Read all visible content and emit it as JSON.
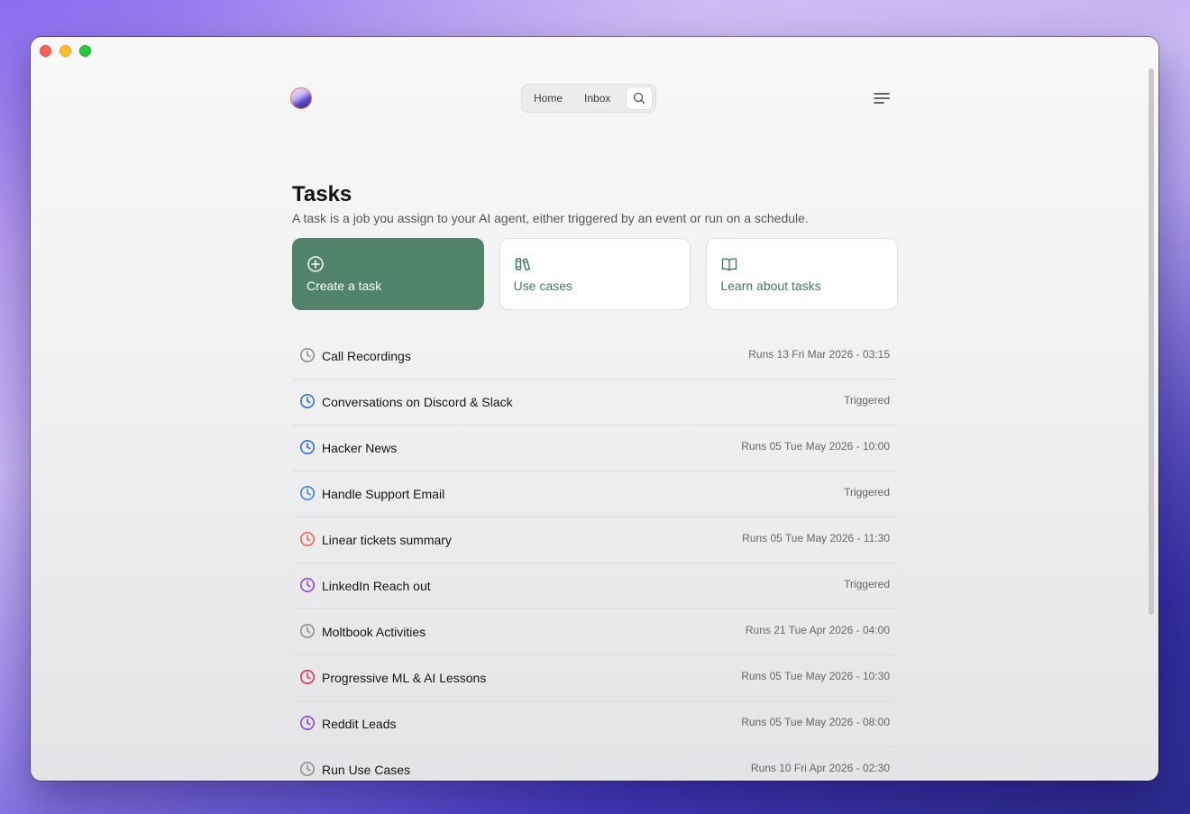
{
  "window": {
    "controls": [
      "close",
      "minimize",
      "zoom"
    ]
  },
  "header": {
    "avatar_icon": "user-avatar",
    "nav": {
      "home": "Home",
      "inbox": "Inbox",
      "search_icon": "search-icon"
    },
    "menu_icon": "menu-icon"
  },
  "page": {
    "title": "Tasks",
    "subtitle": "A task is a job you assign to your AI agent, either triggered by an event or run on a schedule."
  },
  "actions": [
    {
      "label": "Create a task",
      "icon": "plus-circle-icon",
      "primary": true
    },
    {
      "label": "Use cases",
      "icon": "books-icon",
      "primary": false
    },
    {
      "label": "Learn about tasks",
      "icon": "open-book-icon",
      "primary": false
    }
  ],
  "colors": {
    "accent_green": "#51836b",
    "accent_text_green": "#3f7a5d",
    "icon_gray": "#8e8e93",
    "icon_blue": "#2f6fe0",
    "icon_orange": "#ef6a4a",
    "icon_purple": "#8a45e6",
    "icon_red": "#e0344f"
  },
  "tasks": [
    {
      "name": "Call Recordings",
      "status": "Runs 13 Fri Mar 2026 - 03:15",
      "icon": "clock-icon",
      "color": "#8e8e93"
    },
    {
      "name": "Conversations on Discord & Slack",
      "status": "Triggered",
      "icon": "clock-icon",
      "color": "#2f6fe0"
    },
    {
      "name": "Hacker News",
      "status": "Runs 05 Tue May 2026 - 10:00",
      "icon": "clock-icon",
      "color": "#2f6fe0"
    },
    {
      "name": "Handle Support Email",
      "status": "Triggered",
      "icon": "clock-icon",
      "color": "#3b82f6"
    },
    {
      "name": "Linear tickets summary",
      "status": "Runs 05 Tue May 2026 - 11:30",
      "icon": "clock-icon",
      "color": "#ef6a4a"
    },
    {
      "name": "LinkedIn Reach out",
      "status": "Triggered",
      "icon": "clock-icon",
      "color": "#8a45e6"
    },
    {
      "name": "Moltbook Activities",
      "status": "Runs 21 Tue Apr 2026 - 04:00",
      "icon": "clock-icon",
      "color": "#8e8e93"
    },
    {
      "name": "Progressive ML & AI Lessons",
      "status": "Runs 05 Tue May 2026 - 10:30",
      "icon": "clock-icon",
      "color": "#e0344f"
    },
    {
      "name": "Reddit Leads",
      "status": "Runs 05 Tue May 2026 - 08:00",
      "icon": "clock-icon",
      "color": "#8a45e6"
    },
    {
      "name": "Run Use Cases",
      "status": "Runs 10 Fri Apr 2026 - 02:30",
      "icon": "clock-icon",
      "color": "#8e8e93"
    }
  ]
}
